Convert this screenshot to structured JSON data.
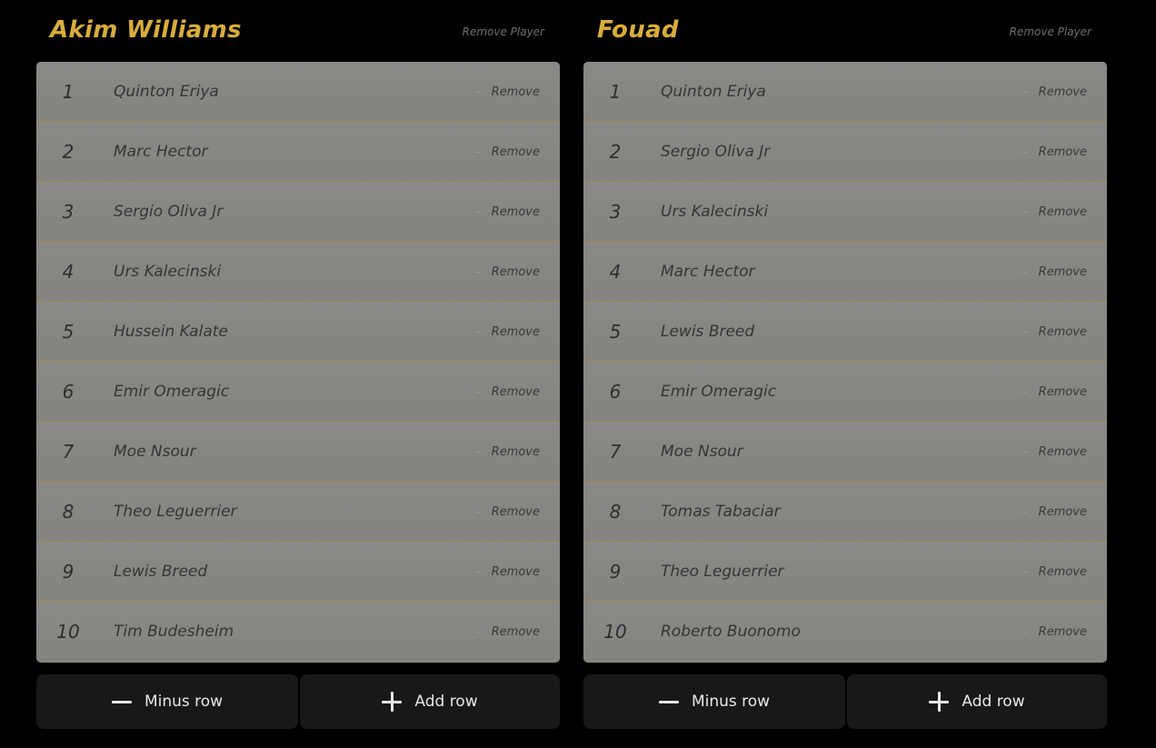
{
  "panels": [
    {
      "player_name": "Akim Williams",
      "remove_player_label": "Remove Player",
      "rows": [
        {
          "rank": "1",
          "name": "Quinton Eriya",
          "remove_label": "Remove"
        },
        {
          "rank": "2",
          "name": "Marc Hector",
          "remove_label": "Remove"
        },
        {
          "rank": "3",
          "name": "Sergio Oliva Jr",
          "remove_label": "Remove"
        },
        {
          "rank": "4",
          "name": "Urs Kalecinski",
          "remove_label": "Remove"
        },
        {
          "rank": "5",
          "name": "Hussein Kalate",
          "remove_label": "Remove"
        },
        {
          "rank": "6",
          "name": "Emir Omeragic",
          "remove_label": "Remove"
        },
        {
          "rank": "7",
          "name": "Moe Nsour",
          "remove_label": "Remove"
        },
        {
          "rank": "8",
          "name": "Theo Leguerrier",
          "remove_label": "Remove"
        },
        {
          "rank": "9",
          "name": "Lewis Breed",
          "remove_label": "Remove"
        },
        {
          "rank": "10",
          "name": "Tim Budesheim",
          "remove_label": "Remove"
        }
      ],
      "minus_row_label": "Minus row",
      "add_row_label": "Add row"
    },
    {
      "player_name": "Fouad",
      "remove_player_label": "Remove Player",
      "rows": [
        {
          "rank": "1",
          "name": "Quinton Eriya",
          "remove_label": "Remove"
        },
        {
          "rank": "2",
          "name": "Sergio Oliva Jr",
          "remove_label": "Remove"
        },
        {
          "rank": "3",
          "name": "Urs Kalecinski",
          "remove_label": "Remove"
        },
        {
          "rank": "4",
          "name": "Marc Hector",
          "remove_label": "Remove"
        },
        {
          "rank": "5",
          "name": "Lewis Breed",
          "remove_label": "Remove"
        },
        {
          "rank": "6",
          "name": "Emir Omeragic",
          "remove_label": "Remove"
        },
        {
          "rank": "7",
          "name": "Moe Nsour",
          "remove_label": "Remove"
        },
        {
          "rank": "8",
          "name": "Tomas Tabaciar",
          "remove_label": "Remove"
        },
        {
          "rank": "9",
          "name": "Theo Leguerrier",
          "remove_label": "Remove"
        },
        {
          "rank": "10",
          "name": "Roberto Buonomo",
          "remove_label": "Remove"
        }
      ],
      "minus_row_label": "Minus row",
      "add_row_label": "Add row"
    }
  ],
  "icons": {
    "minus": "minus-icon",
    "plus": "plus-icon"
  },
  "colors": {
    "background": "#000000",
    "accent_gold": "#d8ad3c",
    "card_gray": "#8a8886",
    "row_divider": "#9a8a55",
    "button_bg": "#181818",
    "button_text": "#e8e8e8"
  }
}
